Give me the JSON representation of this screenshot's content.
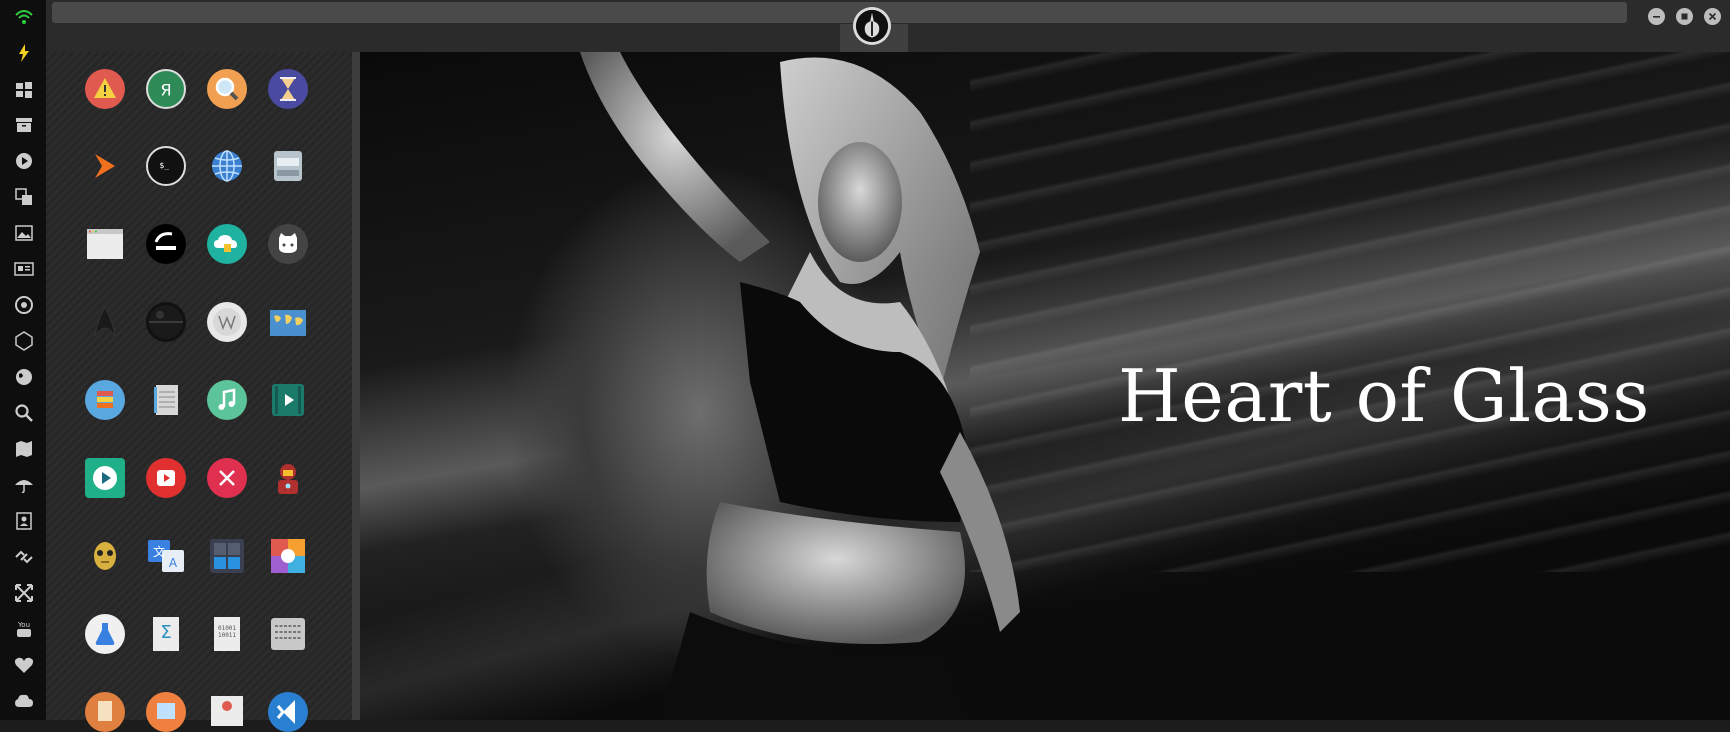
{
  "video": {
    "title": "Heart of Glass"
  },
  "dock": {
    "items": [
      {
        "icon": "wifi-icon"
      },
      {
        "icon": "lightning-icon"
      },
      {
        "icon": "windows-icon"
      },
      {
        "icon": "archive-icon"
      },
      {
        "icon": "play-circle-icon"
      },
      {
        "icon": "translate-icon"
      },
      {
        "icon": "image-icon"
      },
      {
        "icon": "news-icon"
      },
      {
        "icon": "empire-icon"
      },
      {
        "icon": "hexagon-icon"
      },
      {
        "icon": "globe-icon"
      },
      {
        "icon": "search-icon"
      },
      {
        "icon": "map-icon"
      },
      {
        "icon": "umbrella-icon"
      },
      {
        "icon": "contacts-icon"
      },
      {
        "icon": "link-icon"
      },
      {
        "icon": "fullscreen-icon"
      },
      {
        "icon": "youtube-icon"
      },
      {
        "icon": "heart-icon"
      },
      {
        "icon": "cloud-icon"
      }
    ]
  },
  "window_controls": [
    "minimize-icon",
    "maximize-icon",
    "close-icon"
  ],
  "apps": [
    {
      "icon": "warning-app-icon",
      "color": "#e05a4f"
    },
    {
      "icon": "yandex-app-icon",
      "color": "#2e8b57"
    },
    {
      "icon": "search-app-icon",
      "color": "#f0a050"
    },
    {
      "icon": "hourglass-app-icon",
      "color": "#4a4aa0"
    },
    {
      "icon": "arrow-app-icon",
      "color": "#f07020"
    },
    {
      "icon": "terminal-app-icon",
      "color": "#111111"
    },
    {
      "icon": "globe-app-icon",
      "color": "#3a7fd0"
    },
    {
      "icon": "drive-app-icon",
      "color": "#b8c4cc"
    },
    {
      "icon": "window-app-icon",
      "color": "#dddddd"
    },
    {
      "icon": "steam-app-icon",
      "color": "#000000"
    },
    {
      "icon": "cloud-lock-app-icon",
      "color": "#20b2a0"
    },
    {
      "icon": "github-app-icon",
      "color": "#444444"
    },
    {
      "icon": "starfleet-app-icon",
      "color": "#1a1a1a"
    },
    {
      "icon": "deathstar-app-icon",
      "color": "#111111"
    },
    {
      "icon": "wikipedia-app-icon",
      "color": "#e8e8e8"
    },
    {
      "icon": "worldmap-app-icon",
      "color": "#4a90d0"
    },
    {
      "icon": "books-app-icon",
      "color": "#5aa8e0"
    },
    {
      "icon": "notebook-app-icon",
      "color": "#d8d8d8"
    },
    {
      "icon": "music-app-icon",
      "color": "#5cc49a"
    },
    {
      "icon": "video-app-icon",
      "color": "#1c7a6a"
    },
    {
      "icon": "play-app-icon",
      "color": "#1fb08a"
    },
    {
      "icon": "youtube-app-icon",
      "color": "#e03030"
    },
    {
      "icon": "close-app-icon",
      "color": "#e03050"
    },
    {
      "icon": "ironman-app-icon",
      "color": "#b03030"
    },
    {
      "icon": "c3po-app-icon",
      "color": "#d8b040"
    },
    {
      "icon": "translate-app-icon",
      "color": "#3a80e0"
    },
    {
      "icon": "calculator-app-icon",
      "color": "#3a4050"
    },
    {
      "icon": "photos-app-icon",
      "color": "#f08040"
    },
    {
      "icon": "science-app-icon",
      "color": "#f0f0f0"
    },
    {
      "icon": "math-app-icon",
      "color": "#e8e8e8"
    },
    {
      "icon": "binary-app-icon",
      "color": "#e8e8e8"
    },
    {
      "icon": "keyboard-app-icon",
      "color": "#c8c8c8"
    },
    {
      "icon": "document-app-icon",
      "color": "#e08040"
    },
    {
      "icon": "picture-app-icon",
      "color": "#f08040"
    },
    {
      "icon": "presentation-app-icon",
      "color": "#e8e8e8"
    },
    {
      "icon": "vscode-app-icon",
      "color": "#2a80d0"
    }
  ]
}
